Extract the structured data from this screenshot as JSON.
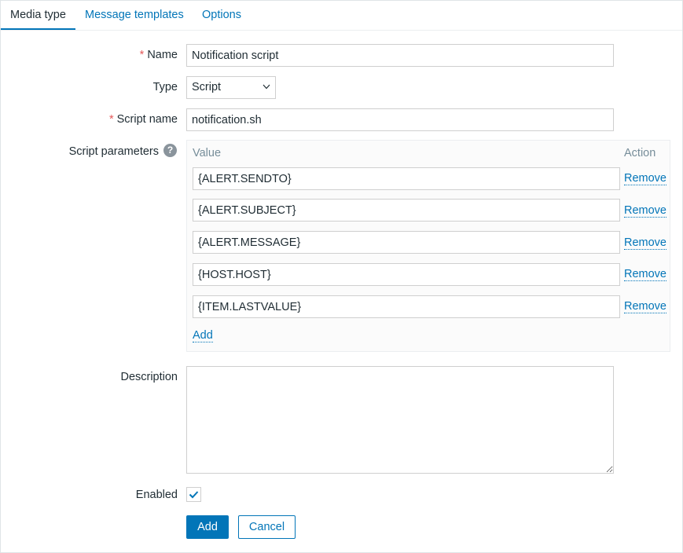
{
  "tabs": [
    {
      "label": "Media type",
      "active": true
    },
    {
      "label": "Message templates",
      "active": false
    },
    {
      "label": "Options",
      "active": false
    }
  ],
  "form": {
    "name": {
      "label": "Name",
      "required": true,
      "value": "Notification script"
    },
    "type": {
      "label": "Type",
      "value": "Script"
    },
    "script_name": {
      "label": "Script name",
      "required": true,
      "value": "notification.sh"
    },
    "script_parameters": {
      "label": "Script parameters",
      "help_glyph": "?",
      "col_value": "Value",
      "col_action": "Action",
      "rows": [
        {
          "value": "{ALERT.SENDTO}",
          "action": "Remove"
        },
        {
          "value": "{ALERT.SUBJECT}",
          "action": "Remove"
        },
        {
          "value": "{ALERT.MESSAGE}",
          "action": "Remove"
        },
        {
          "value": "{HOST.HOST}",
          "action": "Remove"
        },
        {
          "value": "{ITEM.LASTVALUE}",
          "action": "Remove"
        }
      ],
      "add_label": "Add"
    },
    "description": {
      "label": "Description",
      "value": ""
    },
    "enabled": {
      "label": "Enabled",
      "checked": true
    }
  },
  "buttons": {
    "add": "Add",
    "cancel": "Cancel"
  },
  "colors": {
    "accent": "#0275b8",
    "required": "#e45959"
  }
}
